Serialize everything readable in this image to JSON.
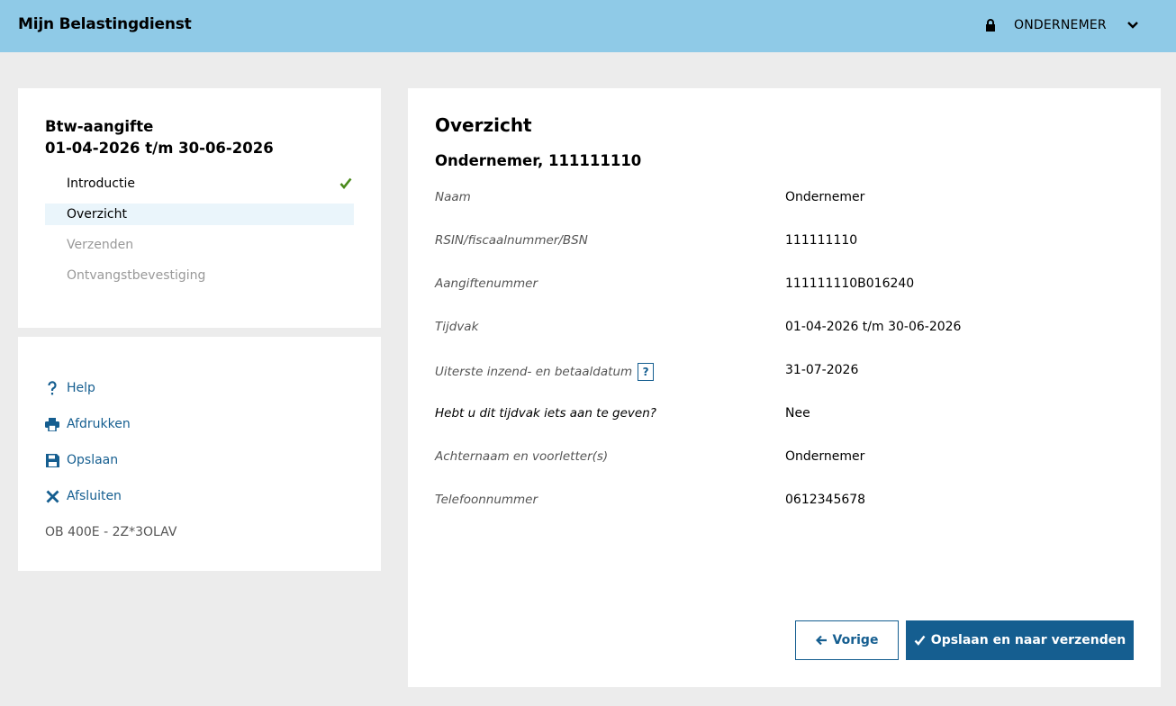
{
  "header": {
    "brand": "Mijn Belastingdienst",
    "role_label": "ONDERNEMER",
    "lock_icon": "lock-icon",
    "chevron_icon": "chevron-down-icon"
  },
  "steps_panel": {
    "title_line1": "Btw-aangifte",
    "title_line2": "01-04-2026 t/m 30-06-2026",
    "steps": [
      {
        "label": "Introductie",
        "state": "done"
      },
      {
        "label": "Overzicht",
        "state": "active"
      },
      {
        "label": "Verzenden",
        "state": "future"
      },
      {
        "label": "Ontvangstbevestiging",
        "state": "future"
      }
    ]
  },
  "tools_panel": {
    "items": [
      {
        "label": "Help",
        "icon": "question-icon"
      },
      {
        "label": "Afdrukken",
        "icon": "printer-icon"
      },
      {
        "label": "Opslaan",
        "icon": "save-icon"
      },
      {
        "label": "Afsluiten",
        "icon": "close-icon"
      }
    ],
    "form_code": "OB 400E - 2Z*3OLAV"
  },
  "main": {
    "title": "Overzicht",
    "subtitle": "Ondernemer, 111111110",
    "fields": [
      {
        "label": "Naam",
        "value": "Ondernemer"
      },
      {
        "label": "RSIN/fiscaalnummer/BSN",
        "value": "111111110"
      },
      {
        "label": "Aangiftenummer",
        "value": "111111110B016240"
      },
      {
        "label": "Tijdvak",
        "value": "01-04-2026 t/m 30-06-2026"
      },
      {
        "label": "Uiterste inzend- en betaaldatum",
        "value": "31-07-2026",
        "help": "?"
      },
      {
        "label": "Hebt u dit tijdvak iets aan te geven?",
        "value": "Nee"
      },
      {
        "label": "Achternaam en voorletter(s)",
        "value": "Ondernemer"
      },
      {
        "label": "Telefoonnummer",
        "value": "0612345678"
      }
    ],
    "prev_label": "Vorige",
    "next_label": "Opslaan en naar verzenden"
  },
  "colors": {
    "header_bg": "#8fcae7",
    "accent": "#155e90",
    "check": "#4a8a1c",
    "active_step_bg": "#eaf5fb"
  }
}
